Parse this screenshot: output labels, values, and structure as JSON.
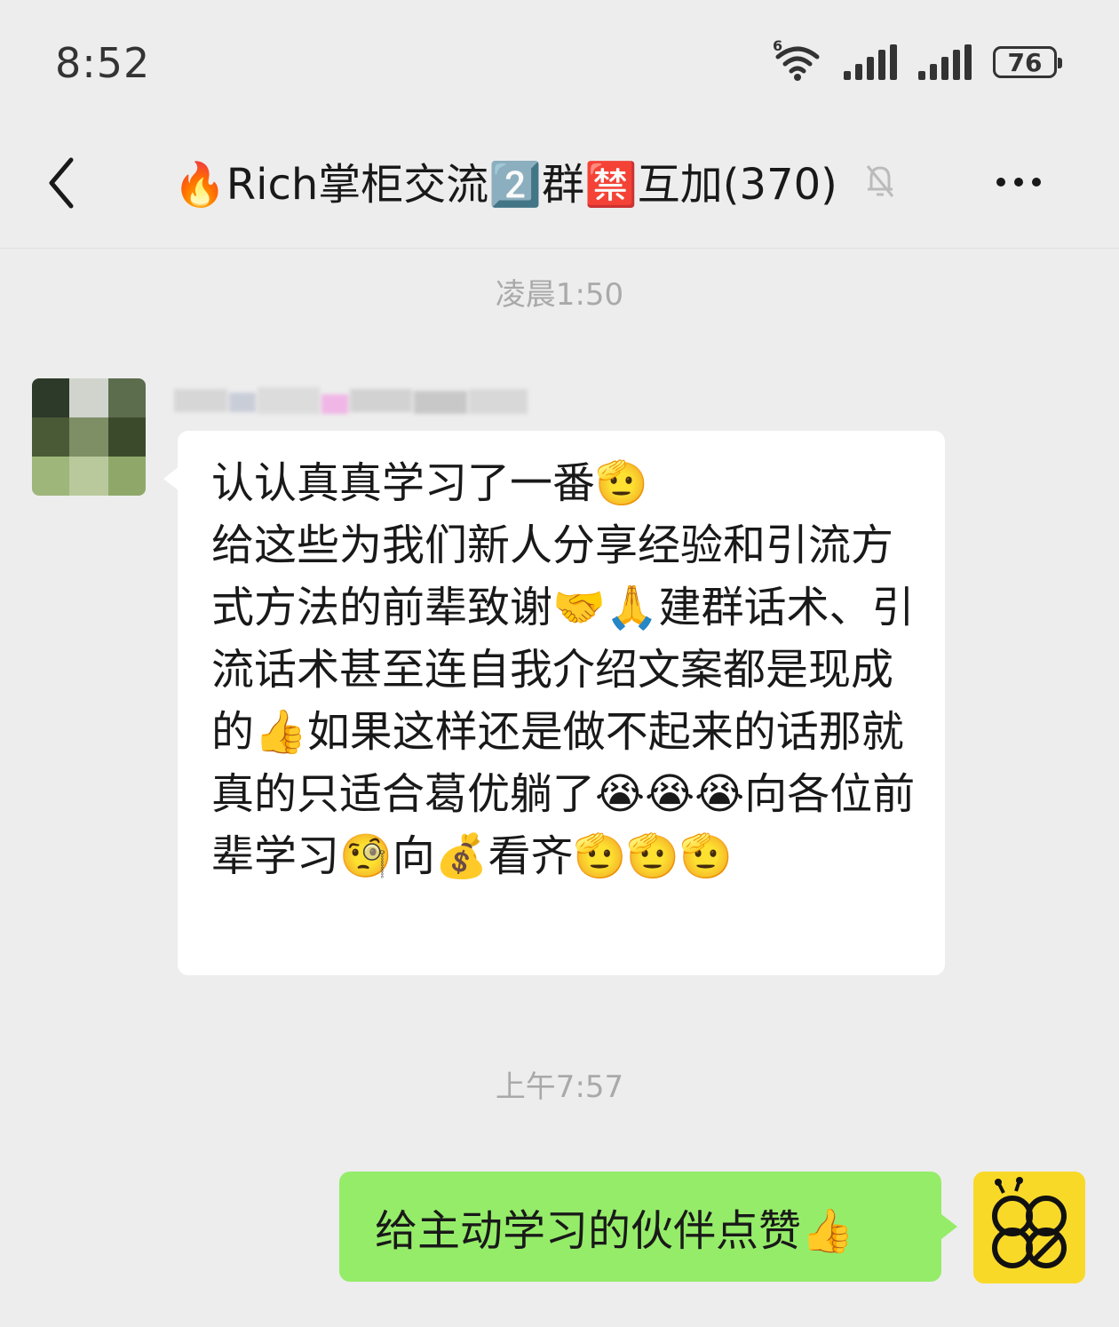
{
  "status_bar": {
    "time": "8:52",
    "network_label": "6",
    "battery_level": "76"
  },
  "header": {
    "back_icon": "chevron-left-icon",
    "title": "🔥Rich掌柜交流2️⃣群🈲互加(370)",
    "mute_icon": "bell-off-icon",
    "more_icon": "more-dots-icon"
  },
  "chat": {
    "timestamp_1": "凌晨1:50",
    "incoming_message": "认认真真学习了一番🫡\n给这些为我们新人分享经验和引流方式方法的前辈致谢🤝🙏建群话术、引流话术甚至连自我介绍文案都是现成的👍如果这样还是做不起来的话那就真的只适合葛优躺了😭😭😭向各位前辈学习🧐向💰看齐🫡🫡🫡",
    "timestamp_2": "上午7:57",
    "outgoing_message": "给主动学习的伙伴点赞👍"
  },
  "colors": {
    "background": "#ededed",
    "incoming_bubble": "#ffffff",
    "outgoing_bubble": "#95ec69",
    "own_avatar": "#f9d928"
  }
}
